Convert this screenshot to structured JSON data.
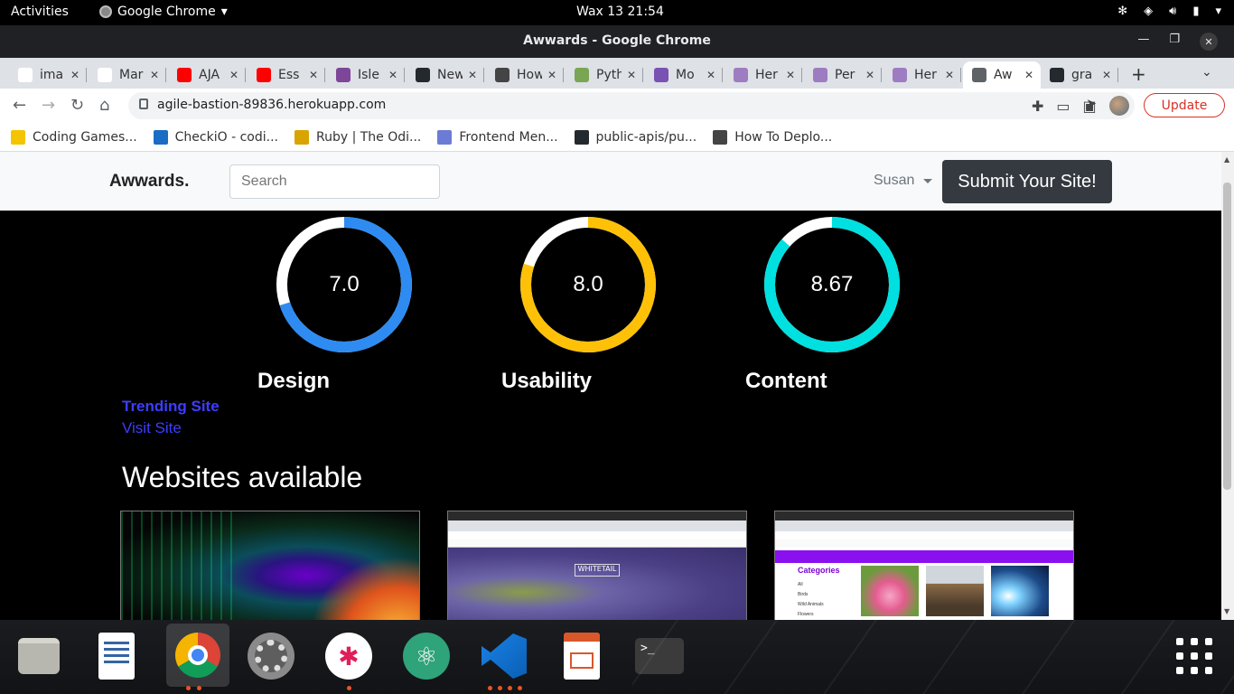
{
  "system_bar": {
    "activities": "Activities",
    "app_menu": "Google Chrome",
    "clock": "Wax 13  21:54"
  },
  "window": {
    "title": "Awwards - Google Chrome"
  },
  "tabs": [
    {
      "label": "ima",
      "icon": "google-icon",
      "color": "#ffffff"
    },
    {
      "label": "Mar",
      "icon": "w-icon",
      "color": "#ffffff"
    },
    {
      "label": "AJA",
      "icon": "youtube-icon",
      "color": "#ff0000"
    },
    {
      "label": "Ess",
      "icon": "youtube-icon",
      "color": "#ff0000"
    },
    {
      "label": "Isle",
      "icon": "tor-icon",
      "color": "#7d4698"
    },
    {
      "label": "New",
      "icon": "github-icon",
      "color": "#24292e"
    },
    {
      "label": "How",
      "icon": "slides-icon",
      "color": "#444444"
    },
    {
      "label": "Pyth",
      "icon": "pytest-icon",
      "color": "#7aa653"
    },
    {
      "label": "Mo",
      "icon": "bootstrap-icon",
      "color": "#7952b3"
    },
    {
      "label": "Her",
      "icon": "heroku-icon",
      "color": "#9e7cc1"
    },
    {
      "label": "Per",
      "icon": "heroku-icon",
      "color": "#9e7cc1"
    },
    {
      "label": "Her",
      "icon": "heroku-icon",
      "color": "#9e7cc1"
    },
    {
      "label": "Aw",
      "icon": "globe-icon",
      "color": "#5f6368",
      "active": true
    },
    {
      "label": "gra",
      "icon": "github-icon",
      "color": "#24292e"
    }
  ],
  "address_bar": {
    "url": "agile-bastion-89836.herokuapp.com",
    "update_label": "Update"
  },
  "bookmarks": [
    {
      "label": "Coding Games...",
      "color": "#f5c400"
    },
    {
      "label": "CheckiO - codi...",
      "color": "#1b6cc4"
    },
    {
      "label": "Ruby | The Odi...",
      "color": "#d9a400"
    },
    {
      "label": "Frontend Men...",
      "color": "#6b7bd6"
    },
    {
      "label": "public-apis/pu...",
      "color": "#24292e"
    },
    {
      "label": "How To Deplo...",
      "color": "#444444"
    }
  ],
  "site": {
    "brand": "Awwards.",
    "search_placeholder": "Search",
    "user": "Susan",
    "submit_label": "Submit Your Site!",
    "trending": "Trending Site",
    "visit": "Visit Site",
    "section_title": "Websites available"
  },
  "ratings": [
    {
      "label": "Design",
      "value": "7.0",
      "score": 7.0,
      "max": 10,
      "color": "#2e8bf2"
    },
    {
      "label": "Usability",
      "value": "8.0",
      "score": 8.0,
      "max": 10,
      "color": "#ffc107"
    },
    {
      "label": "Content",
      "value": "8.67",
      "score": 8.67,
      "max": 10,
      "color": "#00e0e0"
    }
  ],
  "cards": [
    {
      "name": "peacock-feather"
    },
    {
      "name": "whitetail-screenshot",
      "logo": "WHITETAIL"
    },
    {
      "name": "gallery-screenshot",
      "categories": "Categories",
      "items": [
        "All",
        "Birds",
        "Wild Animals",
        "Flowers"
      ]
    }
  ],
  "dock": [
    {
      "name": "files-icon"
    },
    {
      "name": "text-editor-icon"
    },
    {
      "name": "chrome-icon",
      "running": true
    },
    {
      "name": "settings-icon"
    },
    {
      "name": "slack-icon"
    },
    {
      "name": "atom-icon"
    },
    {
      "name": "vscode-icon"
    },
    {
      "name": "impress-icon"
    },
    {
      "name": "terminal-icon"
    }
  ]
}
